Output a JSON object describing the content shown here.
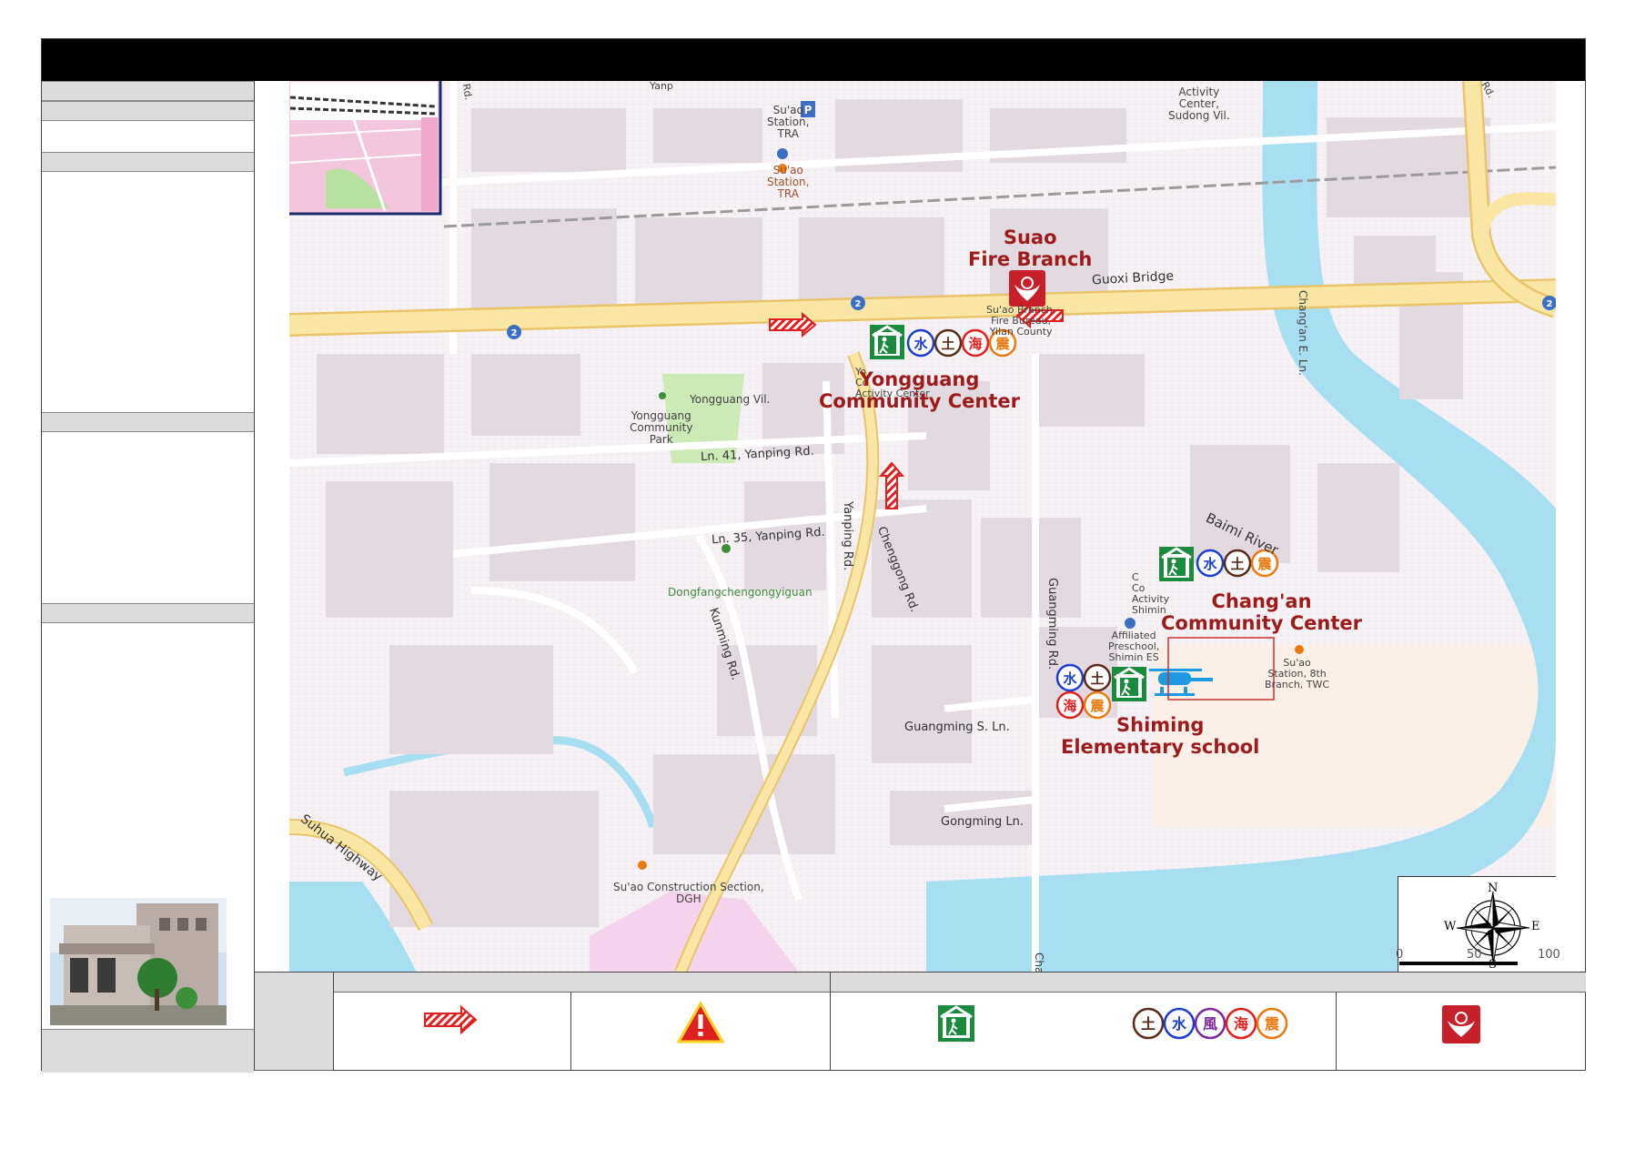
{
  "map": {
    "labels": {
      "suao_station": "Su'ao\nStation,\nTRA",
      "suao_station_tra": "Su'ao\nStation,\nTRA",
      "activity_center_sudong": "Activity\nCenter,\nSudong Vil.",
      "fire_branch_poi": "Su'ao Branch,\nFire Bureau,\nYilan County",
      "guoxi_bridge": "Guoxi Bridge",
      "changan_e_ln": "Chang'an E. Ln.",
      "yongguang_vil": "Yongguang Vil.",
      "yongguang_park": "Yongguang\nCommunity\nPark",
      "yongguang_activity": "Yo\nCo\nActivity Center",
      "ln41": "Ln. 41, Yanping Rd.",
      "ln35": "Ln. 35, Yanping Rd.",
      "yanping_rd": "Yanping Rd.",
      "chenggong_rd": "Chenggong Rd.",
      "guangming_rd": "Guangming Rd.",
      "baimi_river": "Baimi River",
      "dongfang": "Dongfangchengongyiguan",
      "kunming_rd": "Kunming Rd.",
      "changan_activity": "C\nCo\nActivity\nShimin",
      "affiliated_preschool": "Affiliated\nPreschool,\nShimin ES",
      "su_ao_8th": "Su'ao\nStation, 8th\nBranch, TWC",
      "guangming_s_ln": "Guangming S. Ln.",
      "gongming_ln": "Gongming Ln.",
      "suhua_highway": "Suhua Highway",
      "construction_section": "Su'ao Construction Section,\nDGH",
      "cha": "Cha",
      "top_road": "Yanp",
      "rd_top_left": "Rd.",
      "rd_top_right": "Rd."
    },
    "titles": {
      "fire_branch": "Suao\nFire Branch",
      "yongguang": "Yongguang\nCommunity Center",
      "changan": "Chang'an\nCommunity Center",
      "shiming": "Shiming\nElementary school"
    },
    "hazard_glyphs": [
      "土",
      "水",
      "風",
      "海",
      "震"
    ],
    "compass": {
      "n": "N",
      "s": "S",
      "e": "E",
      "w": "W"
    },
    "scale": {
      "ticks": [
        "0",
        "50",
        "100"
      ]
    },
    "route_shields": [
      "2",
      "2",
      "2"
    ],
    "colors": {
      "water": "#a8dff0",
      "road_main": "#f9e6a4",
      "road_edge": "#e8c56a",
      "block": "#e3d9e0",
      "park": "#cde9b6",
      "shelter_green": "#1a8a3c",
      "arrow_red": "#e02020",
      "fire_red": "#c8202a"
    }
  },
  "legend": {
    "hazard_glyphs": [
      "土",
      "水",
      "風",
      "海",
      "震"
    ]
  }
}
